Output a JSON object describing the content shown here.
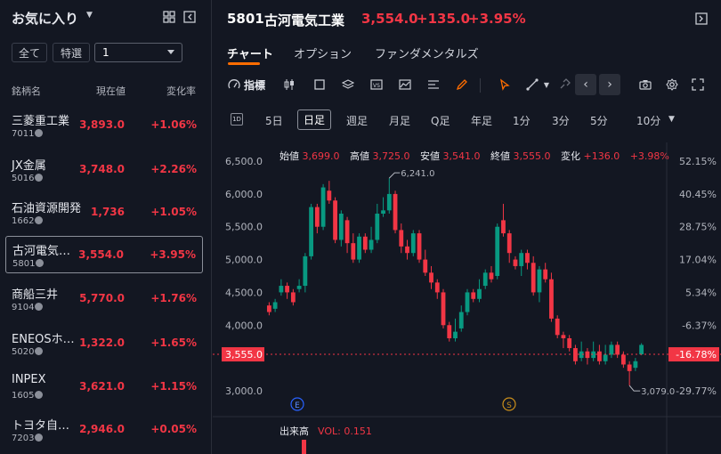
{
  "sidebar": {
    "title": "お気に入り",
    "filters": {
      "all": "全て",
      "featured": "特選",
      "select_value": "1"
    },
    "columns": {
      "name": "銘柄名",
      "price": "現在値",
      "change": "変化率"
    },
    "items": [
      {
        "name": "三菱重工業",
        "code": "7011",
        "price": "3,893.0",
        "change": "+1.06%"
      },
      {
        "name": "JX金属",
        "code": "5016",
        "price": "3,748.0",
        "change": "+2.26%"
      },
      {
        "name": "石油資源開発",
        "code": "1662",
        "price": "1,736",
        "change": "+1.05%"
      },
      {
        "name": "古河電気…",
        "code": "5801",
        "price": "3,554.0",
        "change": "+3.95%"
      },
      {
        "name": "商船三井",
        "code": "9104",
        "price": "5,770.0",
        "change": "+1.76%"
      },
      {
        "name": "ENEOSホ…",
        "code": "5020",
        "price": "1,322.0",
        "change": "+1.65%"
      },
      {
        "name": "INPEX",
        "code": "1605",
        "price": "3,621.0",
        "change": "+1.15%"
      },
      {
        "name": "トヨタ自…",
        "code": "7203",
        "price": "2,946.0",
        "change": "+0.05%"
      }
    ]
  },
  "header": {
    "code": "5801",
    "name": "古河電気工業",
    "price": "3,554.0",
    "change": "+135.0",
    "change_pct": "+3.95%"
  },
  "tabs": [
    "チャート",
    "オプション",
    "ファンダメンタルズ"
  ],
  "toolbar": {
    "indicators_label": "指標"
  },
  "timeframes": [
    "5日",
    "日足",
    "週足",
    "月足",
    "Q足",
    "年足",
    "1分",
    "3分",
    "5分",
    "10分"
  ],
  "timeframe_small_icon": "1D",
  "ohlc": {
    "open_label": "始値",
    "open": "3,699.0",
    "high_label": "高値",
    "high": "3,725.0",
    "low_label": "安値",
    "low": "3,541.0",
    "close_label": "終値",
    "close": "3,555.0",
    "change_label": "変化",
    "change": "+136.0",
    "change_pct": "+3.98%"
  },
  "volume": {
    "label": "出来高",
    "value_label": "VOL: 0.151"
  },
  "markers": {
    "earnings": "E",
    "split": "S"
  },
  "annotations": {
    "high": "6,241.0",
    "low": "3,079.0"
  },
  "current_price_tag": "3,555.0",
  "current_pct_tag": "-16.78%",
  "colors": {
    "up": "#089981",
    "down": "#f23645",
    "accent": "#ff6d00",
    "background": "#131722"
  },
  "chart_data": {
    "type": "candlestick",
    "y_ticks": [
      "6,500.0",
      "6,000.0",
      "5,500.0",
      "5,000.0",
      "4,500.0",
      "4,000.0",
      "3,000.0"
    ],
    "pct_ticks": [
      "52.15%",
      "40.45%",
      "28.75%",
      "17.04%",
      "5.34%",
      "-6.37%",
      "-29.77%"
    ],
    "ylim": [
      2850,
      6650
    ],
    "candles": [
      [
        4300,
        4200,
        4350,
        4150
      ],
      [
        4250,
        4350,
        4400,
        4200
      ],
      [
        4500,
        4600,
        4700,
        4450
      ],
      [
        4600,
        4500,
        4650,
        4400
      ],
      [
        4500,
        4350,
        4550,
        4300
      ],
      [
        4550,
        4600,
        4700,
        4500
      ],
      [
        4600,
        5050,
        5100,
        4500
      ],
      [
        5050,
        5800,
        5850,
        5000
      ],
      [
        5800,
        5500,
        5850,
        5400
      ],
      [
        5500,
        6100,
        6150,
        5450
      ],
      [
        6050,
        5900,
        6200,
        5850
      ],
      [
        5900,
        5300,
        5950,
        5250
      ],
      [
        5300,
        5700,
        5750,
        5200
      ],
      [
        5600,
        5250,
        5650,
        5100
      ],
      [
        5250,
        5000,
        5400,
        4950
      ],
      [
        5000,
        5350,
        5400,
        4950
      ],
      [
        5350,
        5150,
        5400,
        5100
      ],
      [
        5150,
        5300,
        5500,
        5100
      ],
      [
        5300,
        5700,
        5850,
        5250
      ],
      [
        5700,
        5750,
        5950,
        5650
      ],
      [
        5750,
        6000,
        6241,
        5700
      ],
      [
        6000,
        5450,
        6050,
        5400
      ],
      [
        5450,
        5200,
        5550,
        5100
      ],
      [
        5200,
        5100,
        5300,
        5000
      ],
      [
        5100,
        5400,
        5450,
        5050
      ],
      [
        5400,
        5000,
        5450,
        4950
      ],
      [
        5000,
        4800,
        5150,
        4750
      ],
      [
        4800,
        4650,
        4900,
        4550
      ],
      [
        4650,
        4500,
        4700,
        4400
      ],
      [
        4500,
        4000,
        4550,
        3950
      ],
      [
        4000,
        3800,
        4050,
        3750
      ],
      [
        3800,
        3900,
        4100,
        3750
      ],
      [
        3950,
        4200,
        4300,
        3900
      ],
      [
        4200,
        4500,
        4550,
        4150
      ],
      [
        4500,
        4400,
        4550,
        4350
      ],
      [
        4400,
        4550,
        4700,
        4350
      ],
      [
        4600,
        4800,
        4850,
        4550
      ],
      [
        4800,
        4700,
        4900,
        4650
      ],
      [
        4750,
        5500,
        5550,
        4700
      ],
      [
        5600,
        5400,
        5850,
        5350
      ],
      [
        5400,
        5100,
        5450,
        4950
      ],
      [
        5000,
        4900,
        5050,
        4850
      ],
      [
        4900,
        5100,
        5150,
        4750
      ],
      [
        5100,
        4950,
        5150,
        4850
      ],
      [
        4950,
        4500,
        5050,
        4450
      ],
      [
        4500,
        4850,
        4900,
        4350
      ],
      [
        4850,
        4700,
        4950,
        4650
      ],
      [
        4700,
        4100,
        4800,
        4050
      ],
      [
        4100,
        3850,
        4150,
        3800
      ],
      [
        3850,
        3800,
        3900,
        3650
      ],
      [
        3800,
        3650,
        3850,
        3600
      ],
      [
        3650,
        3450,
        3700,
        3400
      ],
      [
        3500,
        3600,
        3750,
        3450
      ],
      [
        3600,
        3500,
        3650,
        3400
      ],
      [
        3500,
        3600,
        3750,
        3450
      ],
      [
        3600,
        3450,
        3700,
        3400
      ],
      [
        3450,
        3550,
        3700,
        3400
      ],
      [
        3550,
        3700,
        3750,
        3500
      ],
      [
        3700,
        3550,
        3750,
        3500
      ],
      [
        3550,
        3400,
        3600,
        3350
      ],
      [
        3400,
        3300,
        3450,
        3079
      ],
      [
        3350,
        3450,
        3500,
        3300
      ],
      [
        3555,
        3699,
        3725,
        3541
      ]
    ]
  }
}
